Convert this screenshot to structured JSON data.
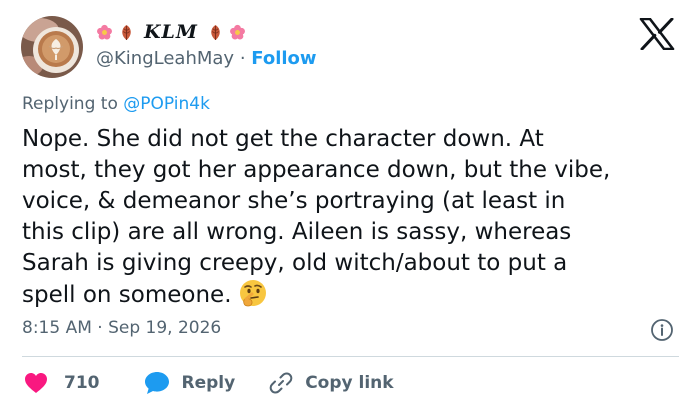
{
  "user": {
    "display_name": "KLM",
    "handle": "@KingLeahMay",
    "separator": "·",
    "follow_label": "Follow",
    "avatar_icon": "coffee-latte-art-avatar",
    "name_decor_icons": [
      "flower-icon",
      "leaf-icon",
      "leaf-icon",
      "flower-icon"
    ]
  },
  "platform_icon": "x-logo",
  "reply": {
    "prefix": "Replying to",
    "mention": "@POPin4k"
  },
  "tweet": {
    "text": "Nope. She did not get the character down. At\nmost, they got her appearance down, but the vibe,\nvoice, & demeanor she’s portraying (at least in\nthis clip) are all wrong. Aileen is sassy, whereas\nSarah is giving creepy, old witch/about to put a\nspell on someone.",
    "trailing_emoji": "thinking-face-emoji"
  },
  "timestamp": "8:15 AM · Sep 19, 2026",
  "actions": {
    "like_count": "710",
    "reply_label": "Reply",
    "copy_label": "Copy link"
  },
  "colors": {
    "accent": "#1d9bf0",
    "like": "#f91880",
    "secondary_text": "#536471",
    "divider": "#cfd9de"
  }
}
